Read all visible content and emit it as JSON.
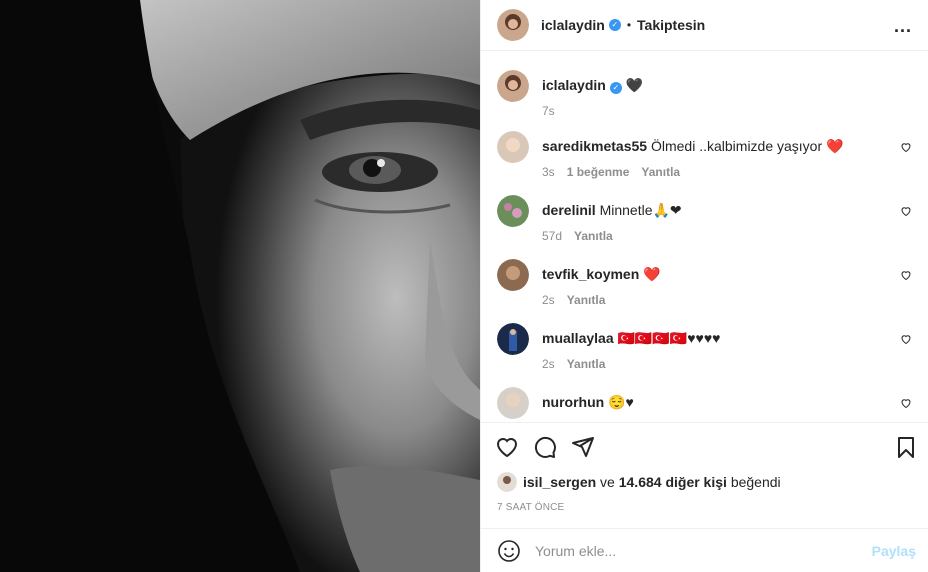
{
  "header": {
    "username": "iclalaydin",
    "separator": "•",
    "follow_status": "Takiptesin",
    "more": "..."
  },
  "caption": {
    "username": "iclalaydin",
    "text": "🖤",
    "time": "7s"
  },
  "comments": [
    {
      "username": "saredikmetas55",
      "text": "Ölmedi ..kalbimizde yaşıyor ❤️",
      "time": "3s",
      "likes": "1 beğenme",
      "reply": "Yanıtla"
    },
    {
      "username": "derelinil",
      "text": "Minnetle🙏❤",
      "time": "57d",
      "likes": "",
      "reply": "Yanıtla"
    },
    {
      "username": "tevfik_koymen",
      "text": "❤️",
      "time": "2s",
      "likes": "",
      "reply": "Yanıtla"
    },
    {
      "username": "muallaylaa",
      "text": "🇹🇷🇹🇷🇹🇷🇹🇷♥♥♥♥",
      "time": "2s",
      "likes": "",
      "reply": "Yanıtla"
    },
    {
      "username": "nurorhun",
      "text": "😌♥",
      "time": "",
      "likes": "",
      "reply": ""
    }
  ],
  "likes": {
    "username": "isil_sergen",
    "connector": "ve",
    "others": "14.684 diğer kişi",
    "suffix": "beğendi"
  },
  "timestamp": "7 SAAT ÖNCE",
  "add_comment": {
    "placeholder": "Yorum ekle...",
    "share": "Paylaş"
  },
  "colors": {
    "verified": "#3897f0",
    "share_disabled": "#b2dffc",
    "meta_gray": "#8e8e8e"
  }
}
